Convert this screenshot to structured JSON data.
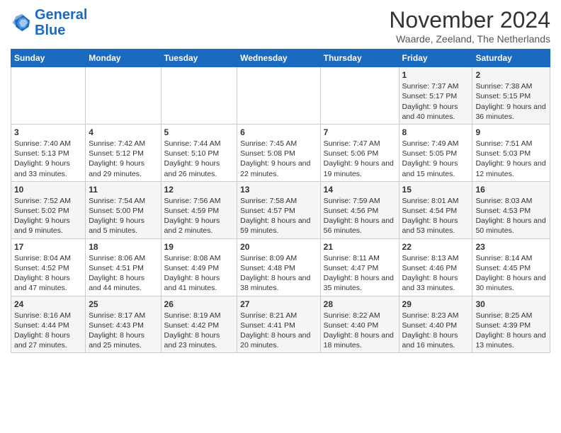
{
  "logo": {
    "line1": "General",
    "line2": "Blue"
  },
  "title": "November 2024",
  "location": "Waarde, Zeeland, The Netherlands",
  "days_of_week": [
    "Sunday",
    "Monday",
    "Tuesday",
    "Wednesday",
    "Thursday",
    "Friday",
    "Saturday"
  ],
  "weeks": [
    [
      {
        "day": "",
        "info": ""
      },
      {
        "day": "",
        "info": ""
      },
      {
        "day": "",
        "info": ""
      },
      {
        "day": "",
        "info": ""
      },
      {
        "day": "",
        "info": ""
      },
      {
        "day": "1",
        "info": "Sunrise: 7:37 AM\nSunset: 5:17 PM\nDaylight: 9 hours and 40 minutes."
      },
      {
        "day": "2",
        "info": "Sunrise: 7:38 AM\nSunset: 5:15 PM\nDaylight: 9 hours and 36 minutes."
      }
    ],
    [
      {
        "day": "3",
        "info": "Sunrise: 7:40 AM\nSunset: 5:13 PM\nDaylight: 9 hours and 33 minutes."
      },
      {
        "day": "4",
        "info": "Sunrise: 7:42 AM\nSunset: 5:12 PM\nDaylight: 9 hours and 29 minutes."
      },
      {
        "day": "5",
        "info": "Sunrise: 7:44 AM\nSunset: 5:10 PM\nDaylight: 9 hours and 26 minutes."
      },
      {
        "day": "6",
        "info": "Sunrise: 7:45 AM\nSunset: 5:08 PM\nDaylight: 9 hours and 22 minutes."
      },
      {
        "day": "7",
        "info": "Sunrise: 7:47 AM\nSunset: 5:06 PM\nDaylight: 9 hours and 19 minutes."
      },
      {
        "day": "8",
        "info": "Sunrise: 7:49 AM\nSunset: 5:05 PM\nDaylight: 9 hours and 15 minutes."
      },
      {
        "day": "9",
        "info": "Sunrise: 7:51 AM\nSunset: 5:03 PM\nDaylight: 9 hours and 12 minutes."
      }
    ],
    [
      {
        "day": "10",
        "info": "Sunrise: 7:52 AM\nSunset: 5:02 PM\nDaylight: 9 hours and 9 minutes."
      },
      {
        "day": "11",
        "info": "Sunrise: 7:54 AM\nSunset: 5:00 PM\nDaylight: 9 hours and 5 minutes."
      },
      {
        "day": "12",
        "info": "Sunrise: 7:56 AM\nSunset: 4:59 PM\nDaylight: 9 hours and 2 minutes."
      },
      {
        "day": "13",
        "info": "Sunrise: 7:58 AM\nSunset: 4:57 PM\nDaylight: 8 hours and 59 minutes."
      },
      {
        "day": "14",
        "info": "Sunrise: 7:59 AM\nSunset: 4:56 PM\nDaylight: 8 hours and 56 minutes."
      },
      {
        "day": "15",
        "info": "Sunrise: 8:01 AM\nSunset: 4:54 PM\nDaylight: 8 hours and 53 minutes."
      },
      {
        "day": "16",
        "info": "Sunrise: 8:03 AM\nSunset: 4:53 PM\nDaylight: 8 hours and 50 minutes."
      }
    ],
    [
      {
        "day": "17",
        "info": "Sunrise: 8:04 AM\nSunset: 4:52 PM\nDaylight: 8 hours and 47 minutes."
      },
      {
        "day": "18",
        "info": "Sunrise: 8:06 AM\nSunset: 4:51 PM\nDaylight: 8 hours and 44 minutes."
      },
      {
        "day": "19",
        "info": "Sunrise: 8:08 AM\nSunset: 4:49 PM\nDaylight: 8 hours and 41 minutes."
      },
      {
        "day": "20",
        "info": "Sunrise: 8:09 AM\nSunset: 4:48 PM\nDaylight: 8 hours and 38 minutes."
      },
      {
        "day": "21",
        "info": "Sunrise: 8:11 AM\nSunset: 4:47 PM\nDaylight: 8 hours and 35 minutes."
      },
      {
        "day": "22",
        "info": "Sunrise: 8:13 AM\nSunset: 4:46 PM\nDaylight: 8 hours and 33 minutes."
      },
      {
        "day": "23",
        "info": "Sunrise: 8:14 AM\nSunset: 4:45 PM\nDaylight: 8 hours and 30 minutes."
      }
    ],
    [
      {
        "day": "24",
        "info": "Sunrise: 8:16 AM\nSunset: 4:44 PM\nDaylight: 8 hours and 27 minutes."
      },
      {
        "day": "25",
        "info": "Sunrise: 8:17 AM\nSunset: 4:43 PM\nDaylight: 8 hours and 25 minutes."
      },
      {
        "day": "26",
        "info": "Sunrise: 8:19 AM\nSunset: 4:42 PM\nDaylight: 8 hours and 23 minutes."
      },
      {
        "day": "27",
        "info": "Sunrise: 8:21 AM\nSunset: 4:41 PM\nDaylight: 8 hours and 20 minutes."
      },
      {
        "day": "28",
        "info": "Sunrise: 8:22 AM\nSunset: 4:40 PM\nDaylight: 8 hours and 18 minutes."
      },
      {
        "day": "29",
        "info": "Sunrise: 8:23 AM\nSunset: 4:40 PM\nDaylight: 8 hours and 16 minutes."
      },
      {
        "day": "30",
        "info": "Sunrise: 8:25 AM\nSunset: 4:39 PM\nDaylight: 8 hours and 13 minutes."
      }
    ]
  ]
}
